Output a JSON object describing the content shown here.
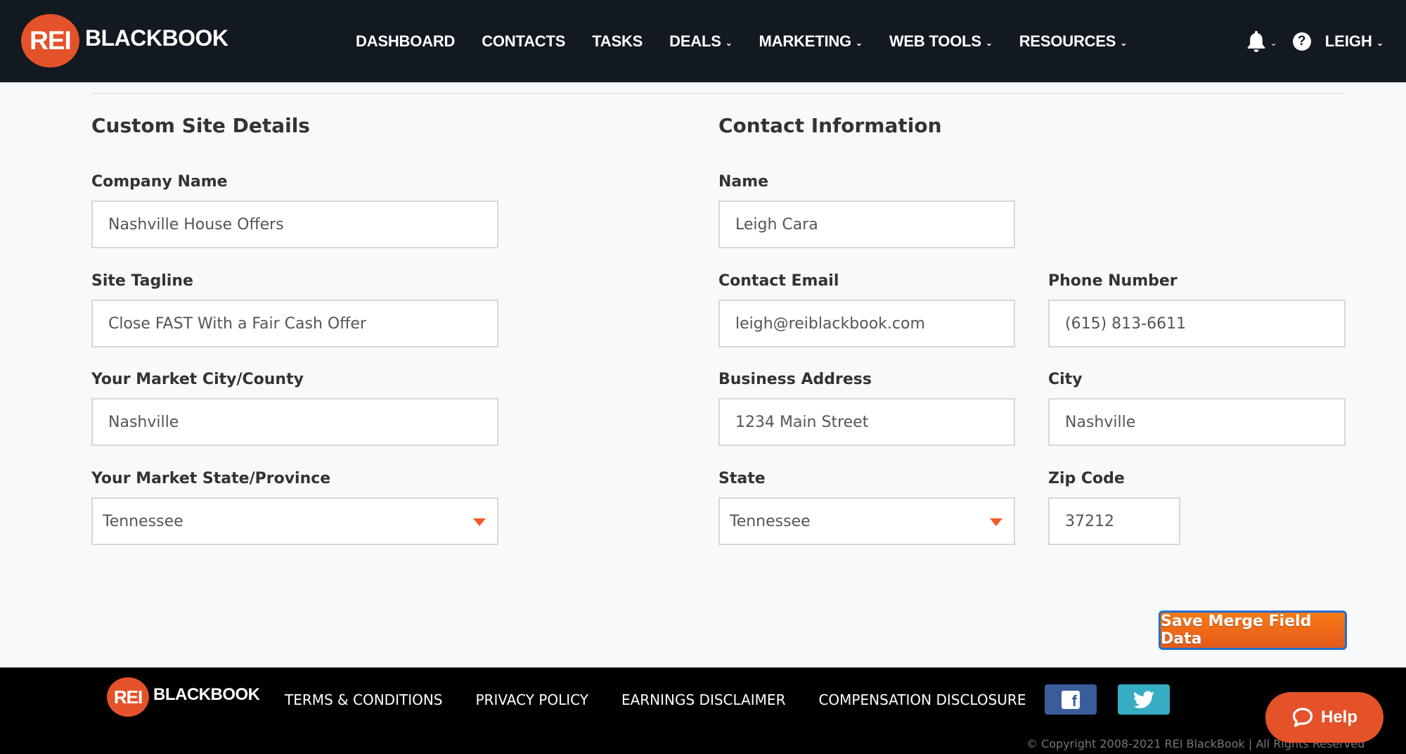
{
  "brand": {
    "logo_mark": "REI",
    "logo_text": "BLACKBOOK",
    "accent_color": "#e4522a"
  },
  "nav": {
    "items": [
      {
        "label": "DASHBOARD",
        "dropdown": false
      },
      {
        "label": "CONTACTS",
        "dropdown": false
      },
      {
        "label": "TASKS",
        "dropdown": false
      },
      {
        "label": "DEALS",
        "dropdown": true
      },
      {
        "label": "MARKETING",
        "dropdown": true
      },
      {
        "label": "WEB TOOLS",
        "dropdown": true
      },
      {
        "label": "RESOURCES",
        "dropdown": true
      }
    ],
    "notifications_icon": "bell-icon",
    "help_icon": "question-circle-icon",
    "help_glyph": "?",
    "user_label": "LEIGH",
    "chevron_glyph": "⌄"
  },
  "custom_site": {
    "title": "Custom Site Details",
    "fields": {
      "company_name": {
        "label": "Company Name",
        "value": "Nashville House Offers"
      },
      "site_tagline": {
        "label": "Site Tagline",
        "value": "Close FAST With a Fair Cash Offer"
      },
      "market_city": {
        "label": "Your Market City/County",
        "value": "Nashville"
      },
      "market_state": {
        "label": "Your Market State/Province",
        "value": "Tennessee"
      }
    }
  },
  "contact_info": {
    "title": "Contact Information",
    "fields": {
      "name": {
        "label": "Name",
        "value": "Leigh Cara"
      },
      "email": {
        "label": "Contact Email",
        "value": "leigh@reiblackbook.com"
      },
      "phone": {
        "label": "Phone Number",
        "value": "(615) 813-6611"
      },
      "address": {
        "label": "Business Address",
        "value": "1234 Main Street"
      },
      "city": {
        "label": "City",
        "value": "Nashville"
      },
      "state": {
        "label": "State",
        "value": "Tennessee"
      },
      "zip": {
        "label": "Zip Code",
        "value": "37212"
      }
    }
  },
  "actions": {
    "save_label": "Save Merge Field Data"
  },
  "footer": {
    "links": [
      "TERMS & CONDITIONS",
      "PRIVACY POLICY",
      "EARNINGS DISCLAIMER",
      "COMPENSATION DISCLOSURE"
    ],
    "social": [
      {
        "name": "facebook",
        "icon": "facebook-icon",
        "color": "#3a5d9c"
      },
      {
        "name": "twitter",
        "icon": "twitter-icon",
        "color": "#37adc3"
      }
    ],
    "copyright": "© Copyright 2008-2021 REI BlackBook | All Rights Reserved",
    "help_label": "Help"
  }
}
